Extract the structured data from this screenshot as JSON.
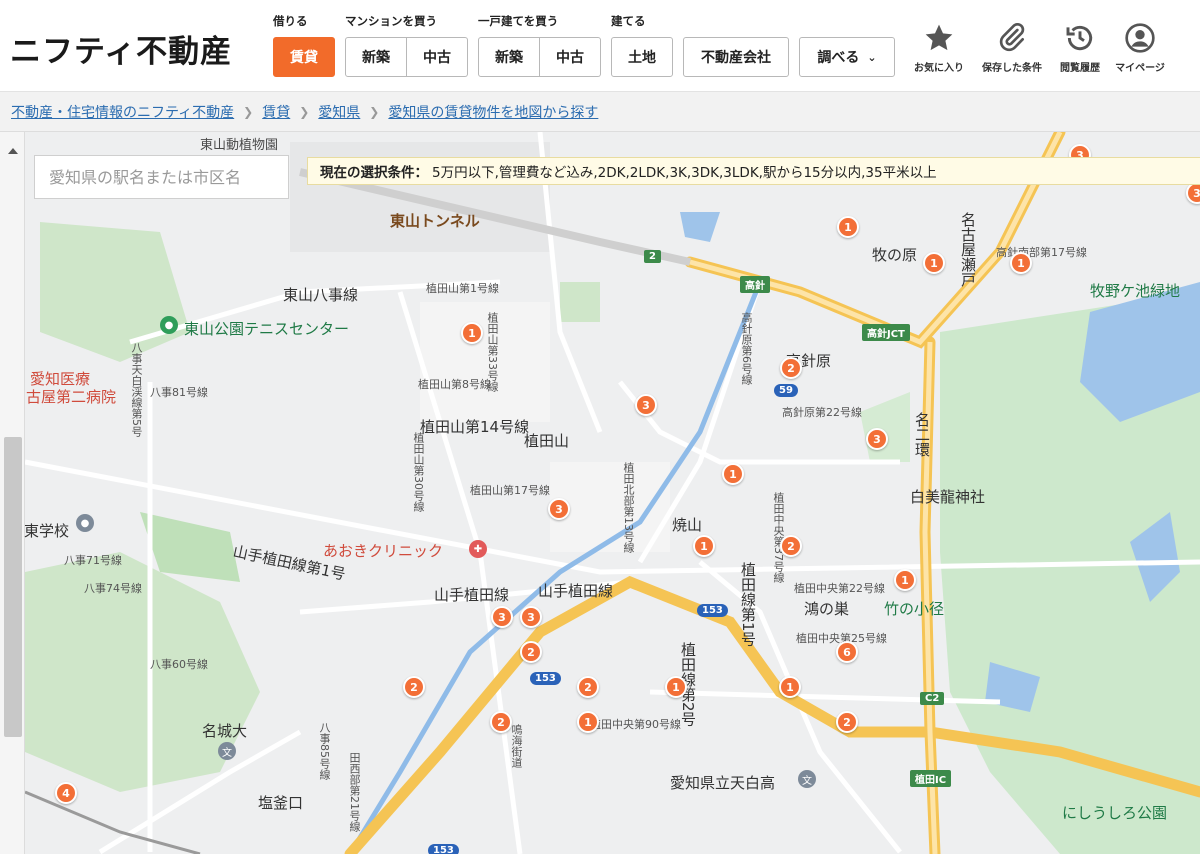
{
  "header": {
    "logo": "ニフティ不動産",
    "groups": {
      "rent_label": "借りる",
      "mansion_label": "マンションを買う",
      "house_label": "一戸建てを買う",
      "build_label": "建てる"
    },
    "buttons": {
      "rent": "賃貸",
      "mansion_new": "新築",
      "mansion_used": "中古",
      "house_new": "新築",
      "house_used": "中古",
      "land": "土地",
      "agency": "不動産会社",
      "research": "調べる"
    },
    "utils": {
      "favorites": "お気に入り",
      "saved_conditions": "保存した条件",
      "history": "閲覧履歴",
      "mypage": "マイページ"
    }
  },
  "breadcrumb": [
    "不動産・住宅情報のニフティ不動産",
    "賃貸",
    "愛知県",
    "愛知県の賃貸物件を地図から探す"
  ],
  "map": {
    "search_placeholder": "愛知県の駅名または市区名",
    "conditions_label": "現在の選択条件：",
    "conditions_value": "5万円以下,管理費など込み,2DK,2LDK,3K,3DK,3LDK,駅から15分以内,35平米以上",
    "labels": {
      "tunnel": "東山トンネル",
      "tennis": "東山公園テニスセンター",
      "hospital1": "愛知医療",
      "hospital2": "古屋第二病院",
      "higashiyama8": "東山八事線",
      "uedayama": "植田山",
      "yakiyama": "焼山",
      "aoki": "あおきクリニック",
      "yamate1": "山手植田線第1号",
      "yamate2": "山手植田線",
      "yamate3": "山手植田線",
      "makinohara": "牧の原",
      "takabari": "高針原",
      "hakuryu": "白美龍神社",
      "takenokomichi": "竹の小径",
      "konosu": "鴻の巣",
      "meijo": "名城大",
      "shiogama": "塩釜口",
      "tenpaku": "愛知県立天白高",
      "nishiura": "にしうしろ公園",
      "makinoike": "牧野ケ池緑地",
      "takabari_jct": "高針JCT",
      "takabari_shield": "高針",
      "ueda_ic": "植田IC",
      "nagoya2": "名二環",
      "nagoya_tobu": "名古屋瀬戸",
      "school": "東学校",
      "yagoto81": "八事81号線",
      "yagoto71": "八事71号線",
      "yagoto74": "八事74号線",
      "yagoto60": "八事60号線",
      "yagoto85": "八事85号線",
      "yagoto_tenpaku": "八事天白渓線第5号",
      "uedayama1": "植田山第1号線",
      "uedayama33": "植田山第33号線",
      "uedayama8": "植田山第8号線",
      "uedayama14": "植田山第14号線",
      "uedayama30": "植田山第30号線",
      "uedayama17": "植田山第17号線",
      "uedakita13": "植田北部第13号線",
      "takabari6": "高針原第6号線",
      "takabari22": "高針原第22号線",
      "uedachuo37": "植田中央第37号線",
      "uedachuo22": "植田中央第22号線",
      "uedachuo25": "植田中央第25号線",
      "uedachuo90": "植田中央第90号線",
      "uedasen2": "植田線第2号",
      "uedasen1": "植田線第1号",
      "higashiyama_zoo": "東山動植物園",
      "takabari_minami": "高針南部第17号線",
      "sakurakaido": "鳴海街道",
      "nishibu21": "田西部第21号線",
      "r153a": "153",
      "r153b": "153",
      "r153c": "153",
      "r59": "59",
      "r2": "2",
      "c2": "C2"
    },
    "pins": [
      "1",
      "3",
      "3",
      "1",
      "1",
      "2",
      "3",
      "1",
      "3",
      "2",
      "1",
      "3",
      "3",
      "3",
      "2",
      "2",
      "1",
      "1",
      "1",
      "1",
      "2",
      "2",
      "6",
      "1",
      "2",
      "4"
    ]
  }
}
